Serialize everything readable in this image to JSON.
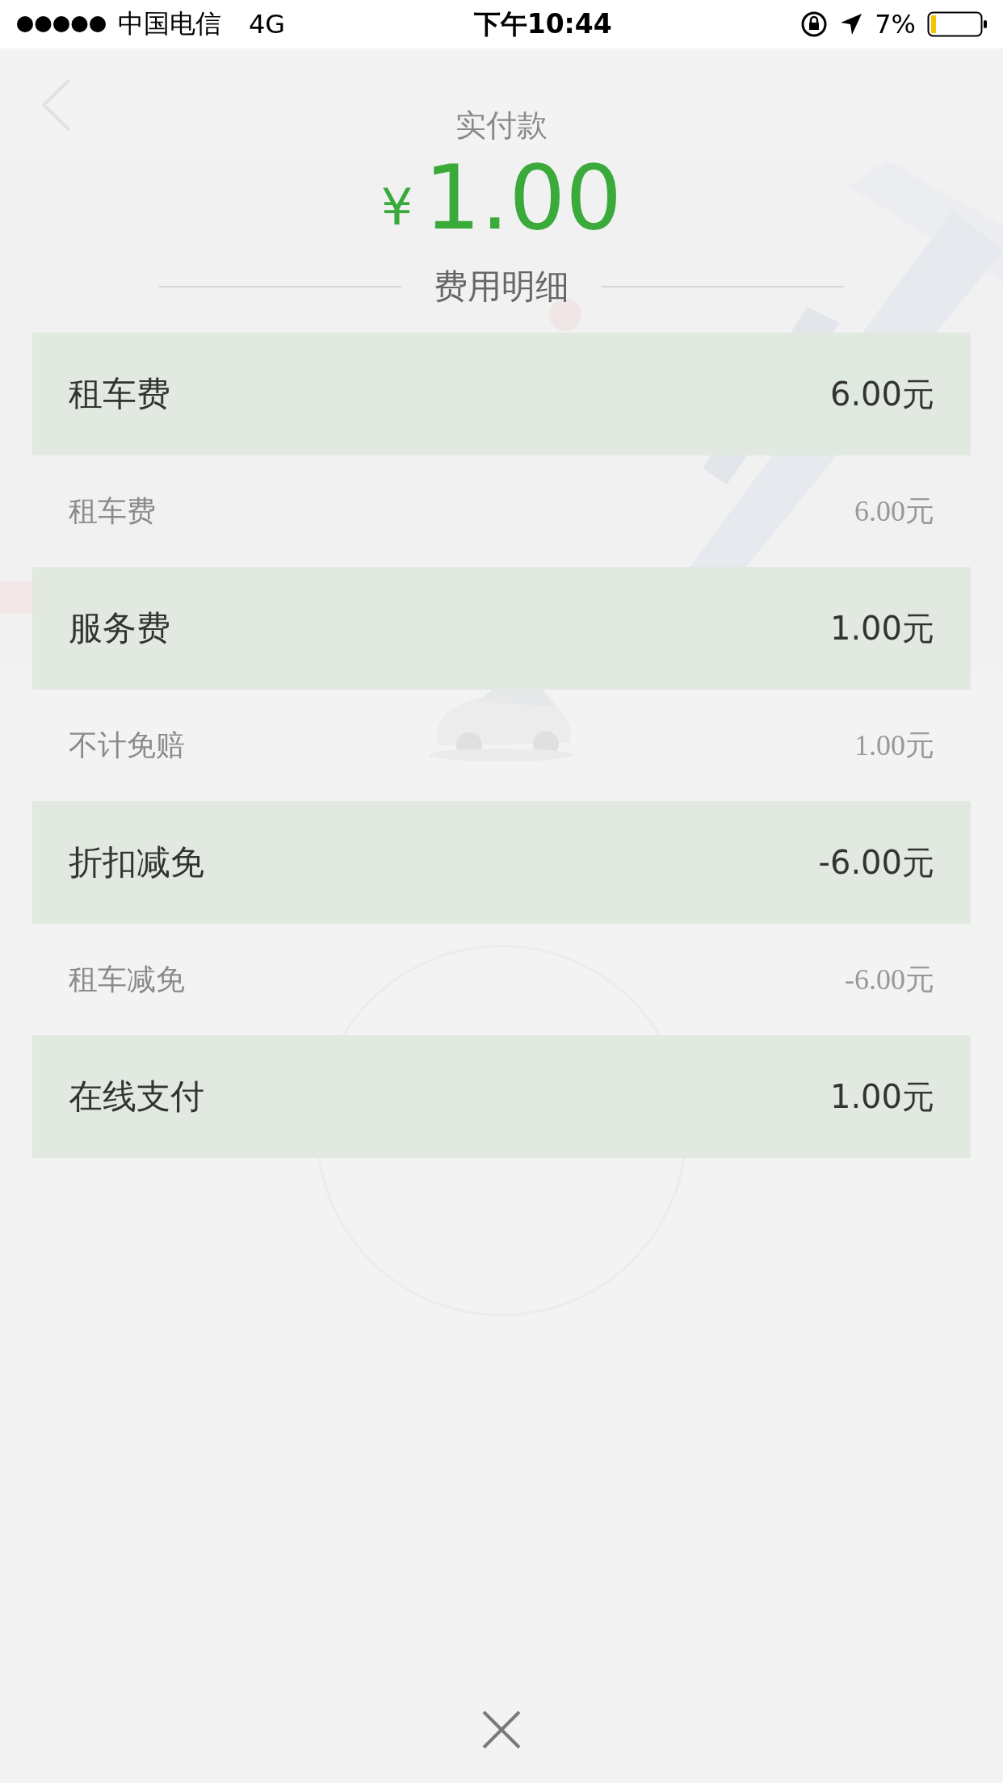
{
  "status_bar": {
    "carrier": "中国电信",
    "network": "4G",
    "time": "下午10:44",
    "battery": "7%"
  },
  "payment": {
    "label": "实付款",
    "currency": "¥",
    "amount": "1.00"
  },
  "details": {
    "title": "费用明细",
    "rows": [
      {
        "kind": "group",
        "label": "租车费",
        "value": "6.00元"
      },
      {
        "kind": "item",
        "label": "租车费",
        "value": "6.00元"
      },
      {
        "kind": "group",
        "label": "服务费",
        "value": "1.00元"
      },
      {
        "kind": "item",
        "label": "不计免赔",
        "value": "1.00元"
      },
      {
        "kind": "group",
        "label": "折扣减免",
        "value": "-6.00元"
      },
      {
        "kind": "item",
        "label": "租车减免",
        "value": "-6.00元"
      },
      {
        "kind": "group",
        "label": "在线支付",
        "value": "1.00元"
      }
    ]
  }
}
